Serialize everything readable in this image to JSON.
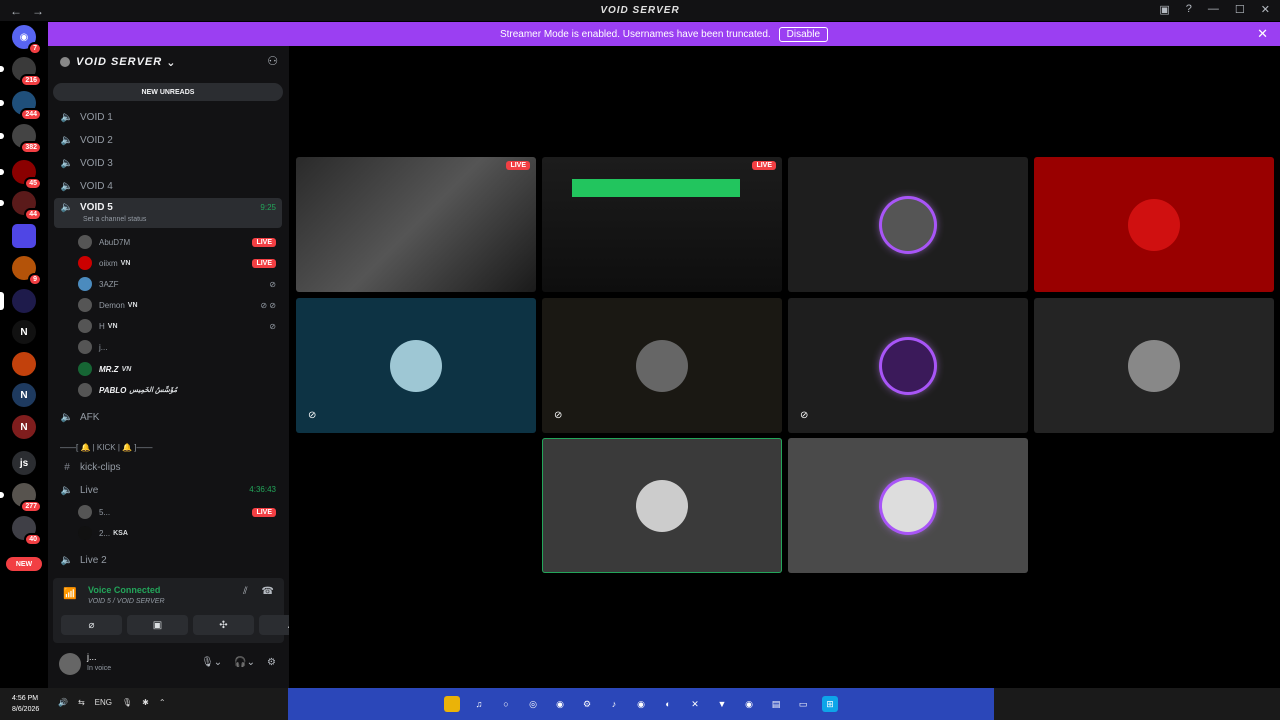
{
  "window": {
    "title": "VOID SERVER",
    "back": "←",
    "forward": "→"
  },
  "banner": {
    "text": "Streamer Mode is enabled. Usernames have been truncated.",
    "disable_label": "Disable",
    "close": "✕"
  },
  "guilds": {
    "badges": [
      "7",
      "216",
      "244",
      "382",
      "45",
      "44",
      "9",
      "277",
      "40"
    ],
    "js_label": "js",
    "new_label": "NEW"
  },
  "server": {
    "name": "VOID SERVER",
    "new_unreads": "NEW UNREADS"
  },
  "channels": {
    "void1": "VOID 1",
    "void2": "VOID 2",
    "void3": "VOID 3",
    "void4": "VOID 4",
    "void5": "VOID 5",
    "void5_time": "9:25",
    "void5_status": "Set a channel status",
    "afk": "AFK",
    "category": "——[ 🔔 | KICK | 🔔 ]——",
    "kick_clips": "kick-clips",
    "live": "Live",
    "live_time": "4:36:43",
    "live2": "Live 2"
  },
  "members": {
    "m1": "AbuD7M",
    "m2": "oiixm",
    "m2_tag": "VN",
    "m3": "3AZF",
    "m4": "Demon",
    "m4_tag": "VN",
    "m5": "H",
    "m5_tag": "VN",
    "m6": "j...",
    "m7": "MR.Z",
    "m7_tag": "VN",
    "m8": "PABLO",
    "m8_tag": "مُؤَسِّسُ الخَمِيس",
    "l1": "5...",
    "l2": "2...",
    "l2_tag": "KSA",
    "live_badge": "LIVE"
  },
  "voice": {
    "connected": "Voice Connected",
    "sub": "VOID 5 / VOID SERVER"
  },
  "user": {
    "name": "j...",
    "status": "In voice"
  },
  "taskbar": {
    "time": "4:56 PM",
    "date": "8/6/2026",
    "lang": "ENG"
  },
  "colors": {
    "accent": "#9b3ff2",
    "online": "#23a55a",
    "live": "#f23f43"
  }
}
